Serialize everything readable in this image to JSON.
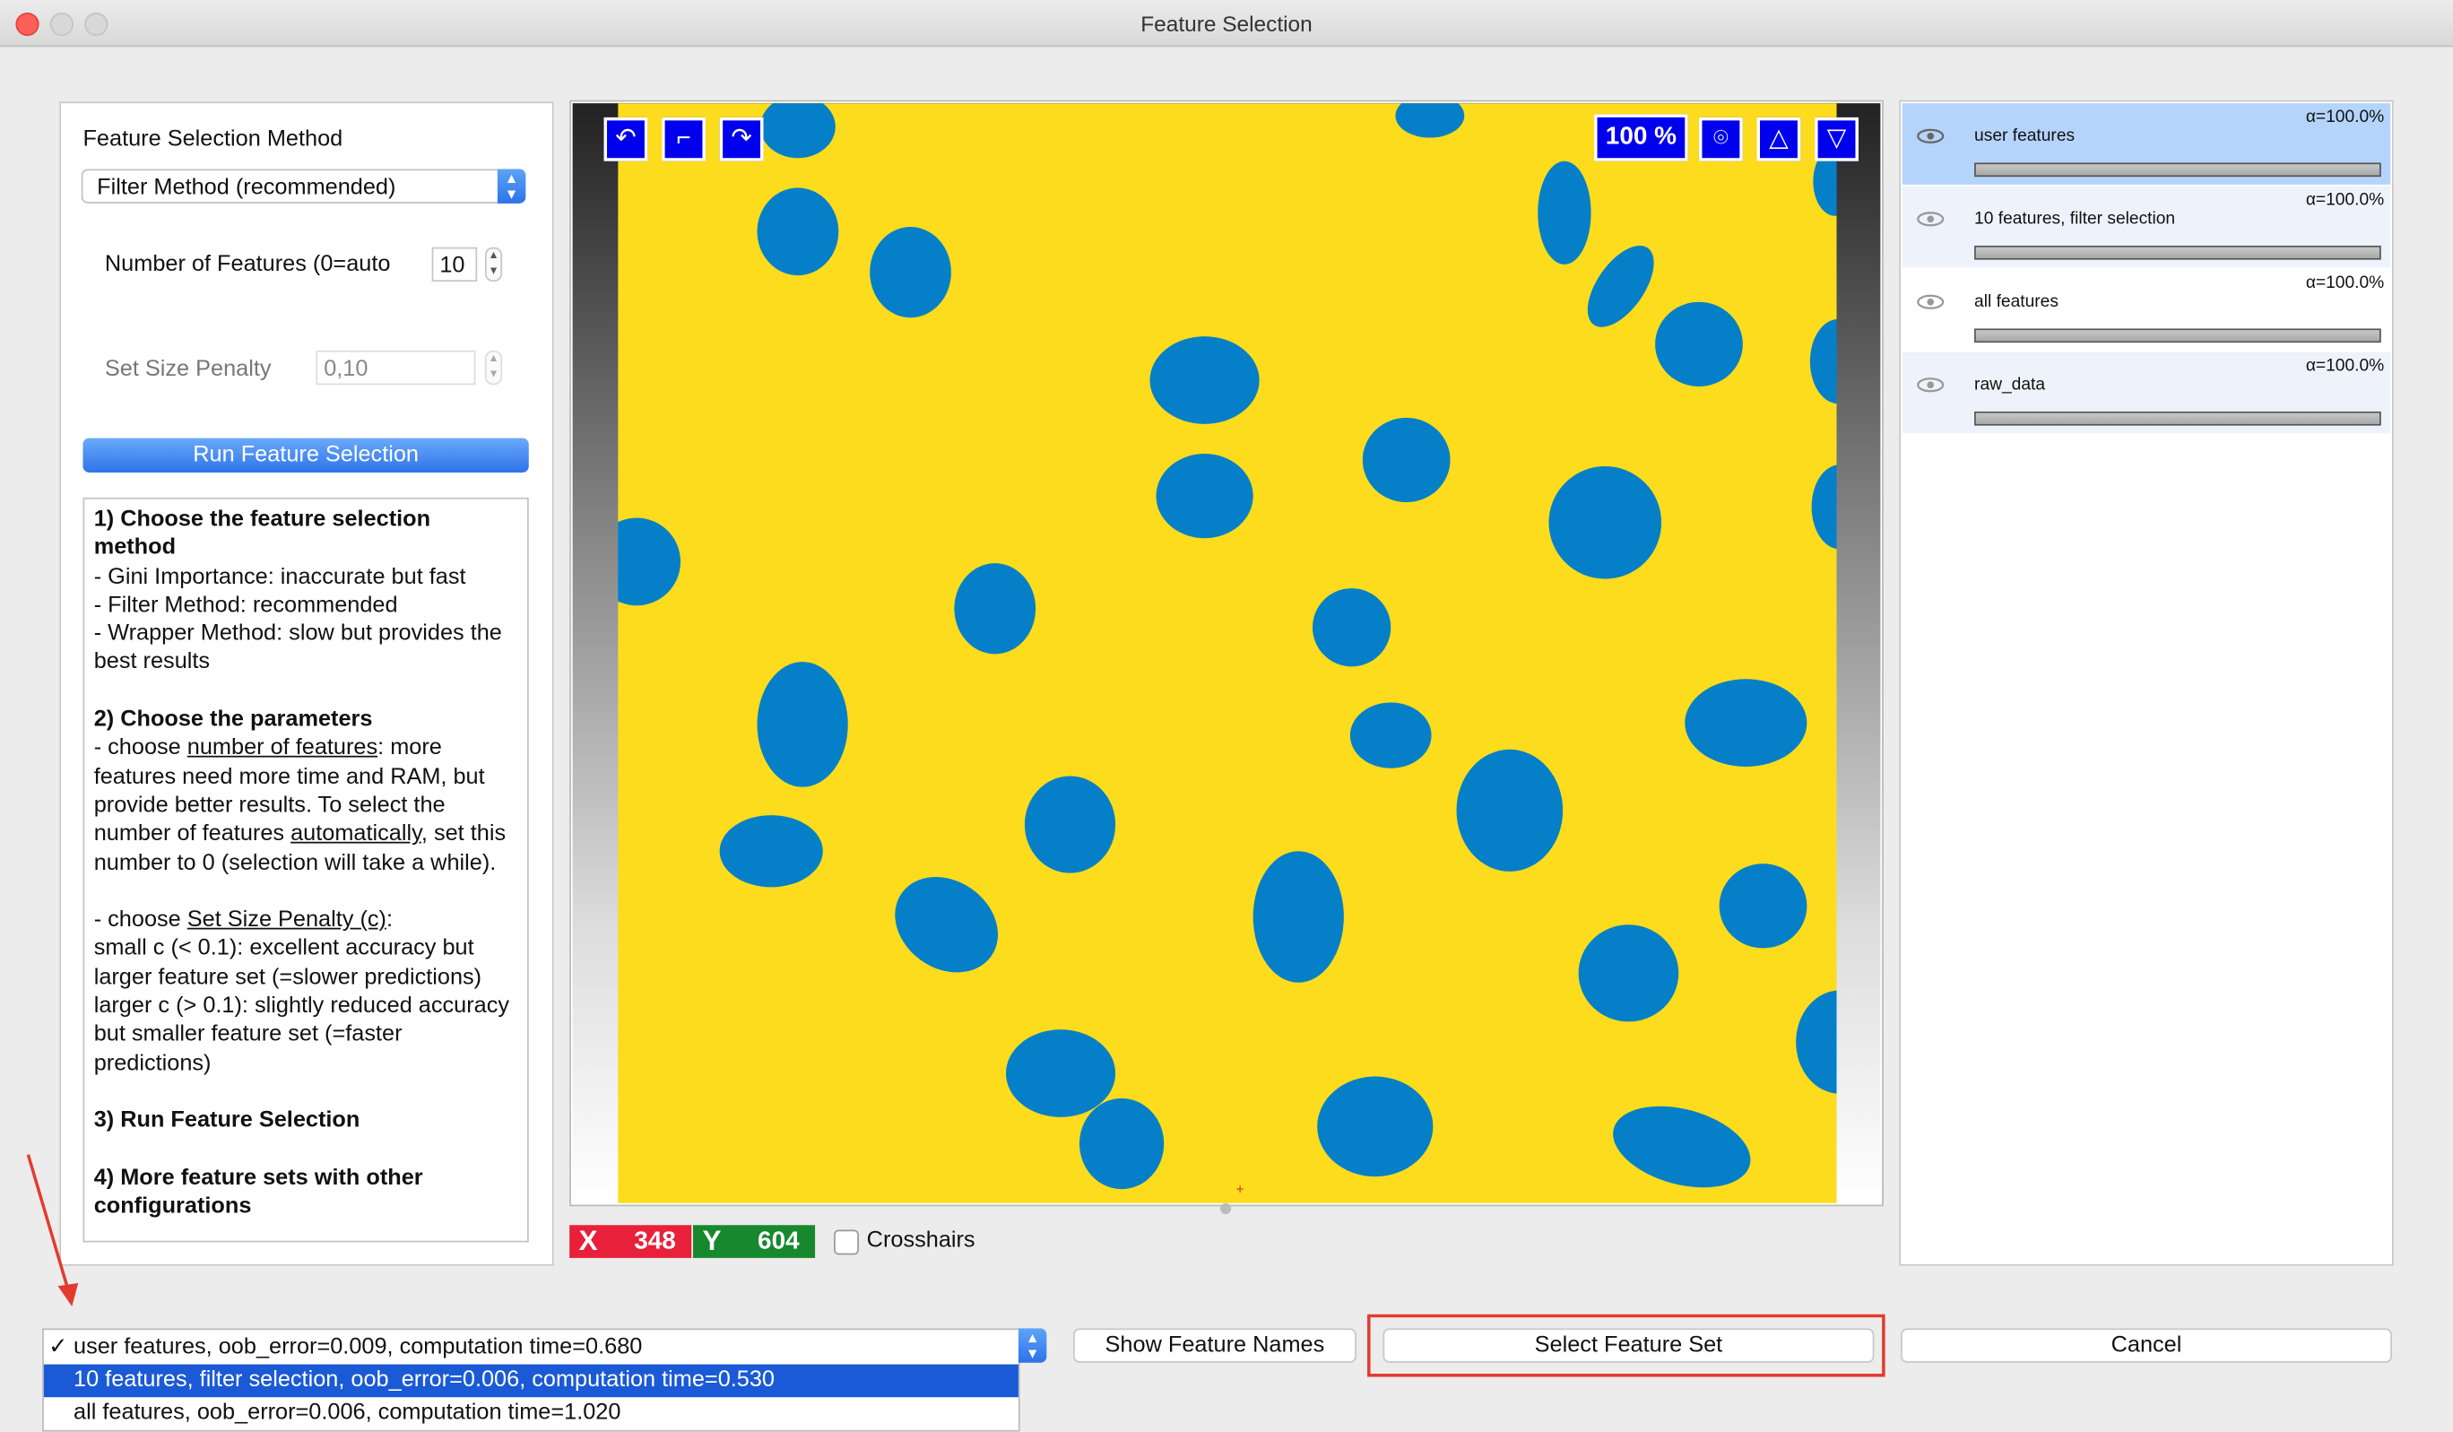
{
  "window": {
    "title": "Feature Selection"
  },
  "left_panel": {
    "method_heading": "Feature Selection Method",
    "method_value": "Filter Method (recommended)",
    "num_features_label": "Number of Features (0=auto",
    "num_features_value": "10",
    "penalty_label": "Set Size Penalty",
    "penalty_value": "0,10",
    "run_button": "Run Feature Selection",
    "help": {
      "s1_title": "1) Choose the feature selection method",
      "s1_l1": "- Gini Importance: inaccurate but fast",
      "s1_l2": "- Filter Method: recommended",
      "s1_l3": "- Wrapper Method: slow but provides the best results",
      "s2_title": "2) Choose the parameters",
      "s2_a_pre": "- choose ",
      "s2_a_link": "number of features",
      "s2_a_post": ": more features need more time and RAM, but provide better results. To select the number of features ",
      "s2_a_link2": "automatically",
      "s2_a_post2": ", set this number to 0 (selection will take a while).",
      "s2_b_pre": "- choose ",
      "s2_b_link": "Set Size Penalty (c)",
      "s2_b_post": ":",
      "s2_b_l1": "small c (< 0.1): excellent accuracy but larger feature set (=slower predictions)",
      "s2_b_l2": "larger c (> 0.1): slightly reduced accuracy but smaller feature set (=faster predictions)",
      "s3_title": "3) Run Feature Selection",
      "s4_title": "4) More feature sets with other configurations"
    }
  },
  "viewer": {
    "zoom": "100 %",
    "x_label": "X",
    "x_value": "348",
    "y_label": "Y",
    "y_value": "604",
    "crosshairs_label": "Crosshairs"
  },
  "layers": [
    {
      "name": "user features",
      "alpha": "α=100.0%"
    },
    {
      "name": "10 features, filter selection",
      "alpha": "α=100.0%"
    },
    {
      "name": "all features",
      "alpha": "α=100.0%"
    },
    {
      "name": "raw_data",
      "alpha": "α=100.0%"
    }
  ],
  "feature_sets": {
    "options": [
      "user features, oob_error=0.009, computation time=0.680",
      "10 features, filter selection, oob_error=0.006, computation time=0.530",
      "all features, oob_error=0.006, computation time=1.020"
    ],
    "checked_index": 0,
    "highlighted_index": 1
  },
  "buttons": {
    "show_names": "Show Feature Names",
    "select_set": "Select Feature Set",
    "cancel": "Cancel"
  },
  "colors": {
    "image_background": "#fcdc1c",
    "blob": "#0580c8",
    "highlight_box": "#e23b2e",
    "annotation_arrow": "#e23b2e"
  }
}
